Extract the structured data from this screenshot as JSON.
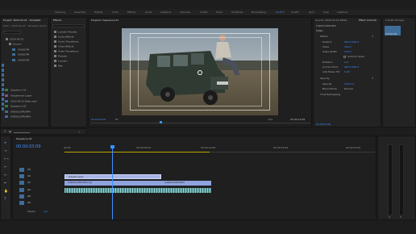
{
  "header": {
    "project_title": "Project: 2020-04-21 - Template",
    "workspace_tabs": [
      "Learning",
      "Assembly",
      "Editing",
      "Color",
      "Effects",
      "Audio",
      "Graphics",
      "Libraries",
      "CLAP1",
      "Trave",
      "All Panels",
      "Normalizing",
      "CLAP 2",
      "CLAP3",
      "Sync",
      "Vlog",
      "Captions"
    ],
    "active_workspace": "CLAP 2"
  },
  "project_panel": {
    "tab": "Project: 2020-04-21 - Template",
    "path": "Main / 2020-04-21 - Template Alpha",
    "items": [
      {
        "label": "2020-04-21",
        "kind": "folder"
      },
      {
        "label": "Source",
        "kind": "folder"
      },
      {
        "label": "S0000 PR",
        "kind": "clip"
      },
      {
        "label": "S0000 PR",
        "kind": "clip"
      },
      {
        "label": "S0000 PR",
        "kind": "clip"
      },
      {
        "label": "Sequence 01",
        "kind": "sequence"
      },
      {
        "label": "Adjustment Layer",
        "kind": "clip"
      },
      {
        "label": "2020-04-21 Blab.mp4",
        "kind": "clip"
      },
      {
        "label": "Sequence 02",
        "kind": "sequence"
      },
      {
        "label": "S4D0015PR.MP4",
        "kind": "clip"
      }
    ]
  },
  "effects_panel": {
    "tab": "Effects",
    "items": [
      "Lumetri Presets",
      "Audio Effects",
      "Audio Transitions",
      "Video Effects",
      "Video Transitions",
      "Presets",
      "Lumetri",
      "Mac"
    ]
  },
  "program_monitor": {
    "tab": "Program: Sequence 01",
    "timecode_left": "00:00:03:09",
    "fit": "Fit",
    "quality": "Full",
    "timecode_right": "00:00:10:09"
  },
  "effect_controls": {
    "tabs": [
      "Source: 2020-04-21 Bl3Ab.mp4",
      "Effect Controls",
      "Lumetri Color"
    ],
    "clip_label": "S4D0015PR.MP4",
    "section_video": "Video",
    "motion": "Motion",
    "params": [
      {
        "name": "Position",
        "value": "960.0  540.0"
      },
      {
        "name": "Scale",
        "value": "100.0"
      },
      {
        "name": "Scale Width",
        "value": "100.0"
      },
      {
        "name": "Uniform Scale",
        "value": ""
      },
      {
        "name": "Rotation",
        "value": "0.0"
      },
      {
        "name": "Anchor Point",
        "value": "960.0  540.0"
      },
      {
        "name": "Anti-flicker Filt",
        "value": "0.00"
      }
    ],
    "opacity": "Opacity",
    "opacity_value": "100.0 %",
    "blend_label": "Blend Mode",
    "blend_value": "Normal",
    "time_remap": "Time Remapping",
    "footer_timecode": "00:00:03:09"
  },
  "media_panel": {
    "tab": "Lumetri Scopes",
    "items": [
      "S0000 PR"
    ]
  },
  "timeline": {
    "tab": "Sequence 01",
    "playhead_timecode": "00:00:03:09",
    "ruler": [
      "00:00",
      "00:00:05:00",
      "00:00:10:00",
      "00:00:15:00",
      "00:00:20:00",
      "00:00:25:00"
    ],
    "tracks": [
      "V3",
      "V2",
      "V1",
      "A1",
      "A2",
      "A3"
    ],
    "master_label": "Master",
    "master_value": "0.0",
    "clips": [
      {
        "label": "Adjust Layer",
        "track": "V2"
      },
      {
        "label": "S4D0015PR.MP4 [V]",
        "track": "V1"
      },
      {
        "label": "S4D0015PR.MP4",
        "track": "V1b"
      }
    ]
  },
  "colors": {
    "accent": "#3e90ff",
    "clip_video": "#a6b5e6",
    "clip_audio": "#4b8a8c",
    "panel": "#232323"
  }
}
